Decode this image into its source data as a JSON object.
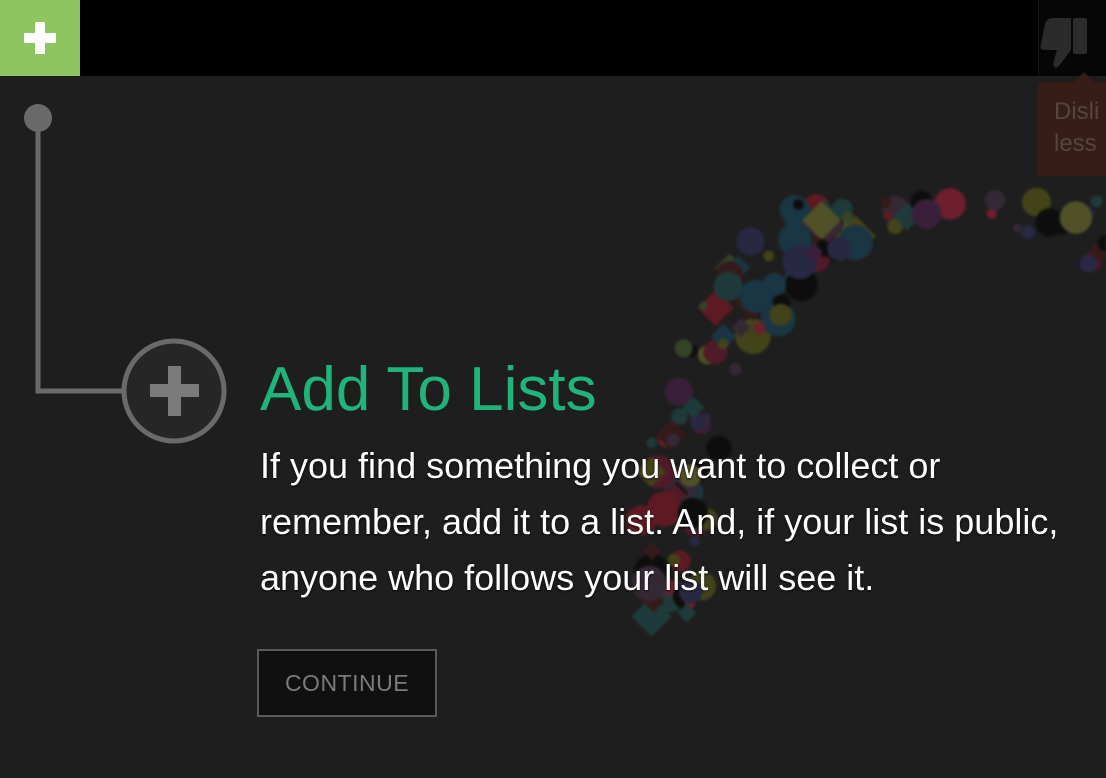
{
  "topbar": {
    "add_icon": "plus-icon",
    "dislike_icon": "thumbs-down-icon",
    "dislike_tooltip": "Disli\nless"
  },
  "tour": {
    "icon": "plus-circle-icon",
    "title": "Add To Lists",
    "description": "If you find something you want to collect or remember, add it to a list. And, if your list is public, anyone who follows your list will see it.",
    "continue_label": "CONTINUE"
  },
  "colors": {
    "accent_green": "#1fb47b",
    "add_button_green": "#8fc560",
    "background": "#1e1e1e"
  }
}
